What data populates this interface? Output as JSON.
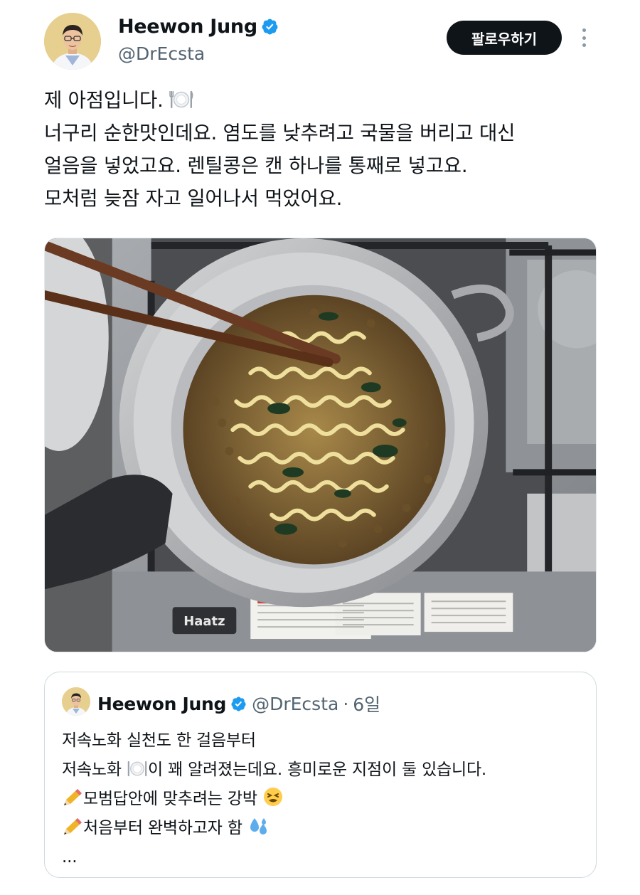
{
  "author": {
    "name": "Heewon Jung",
    "handle": "@DrEcsta",
    "verified": true
  },
  "follow_button": {
    "label": "팔로우하기"
  },
  "tweet": {
    "lines": [
      "제 아점입니다. ",
      "너구리 순한맛인데요. 염도를 낮추려고 국물을 버리고 대신",
      "얼음을 넣었고요. 렌틸콩은 캔 하나를 통째로 넣고요.",
      "모처럼 늦잠 자고 일어나서 먹었어요."
    ],
    "emoji_after_line_1": "plate-with-cutlery-emoji"
  },
  "media": {
    "stove_brand": "Haatz",
    "description_icon": "ramen-pot-photo"
  },
  "quoted_tweet": {
    "name": "Heewon Jung",
    "handle": "@DrEcsta",
    "separator": "·",
    "time": "6일",
    "line1": "저속노화 실천도 한 걸음부터",
    "line2_before": "저속노화 ",
    "line2_after": "이 꽤 알려졌는데요. 흥미로운 지점이 둘 있습니다.",
    "line3": "모범답안에 맞추려는 강박 ",
    "line4": "처음부터 완벽하고자 함 ",
    "line5": "..."
  },
  "colors": {
    "text": "#0f1419",
    "secondary": "#536471",
    "verified": "#1d9bf0",
    "button_bg": "#0f1419",
    "border": "#cfd9de"
  }
}
